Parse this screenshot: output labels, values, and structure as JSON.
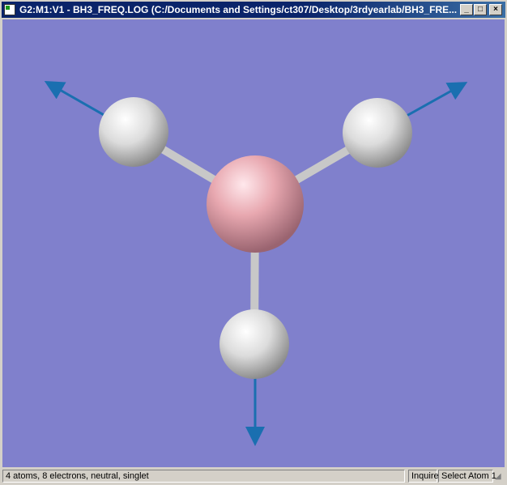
{
  "window": {
    "title": "G2:M1:V1 - BH3_FREQ.LOG (C:/Documents and Settings/ct307/Desktop/3rdyearlab/BH3_FRE...",
    "minimize": "_",
    "maximize": "□",
    "close": "×"
  },
  "molecule": {
    "atoms": [
      {
        "element": "B",
        "color": "#e8a8b0"
      },
      {
        "element": "H",
        "color": "#e8e8e8"
      },
      {
        "element": "H",
        "color": "#e8e8e8"
      },
      {
        "element": "H",
        "color": "#e8e8e8"
      }
    ],
    "background": "#8080cc",
    "vector_color": "#1a6fb0"
  },
  "status": {
    "info": "4 atoms, 8 electrons, neutral, singlet",
    "mode": "Inquire",
    "action": "Select Atom 1"
  }
}
